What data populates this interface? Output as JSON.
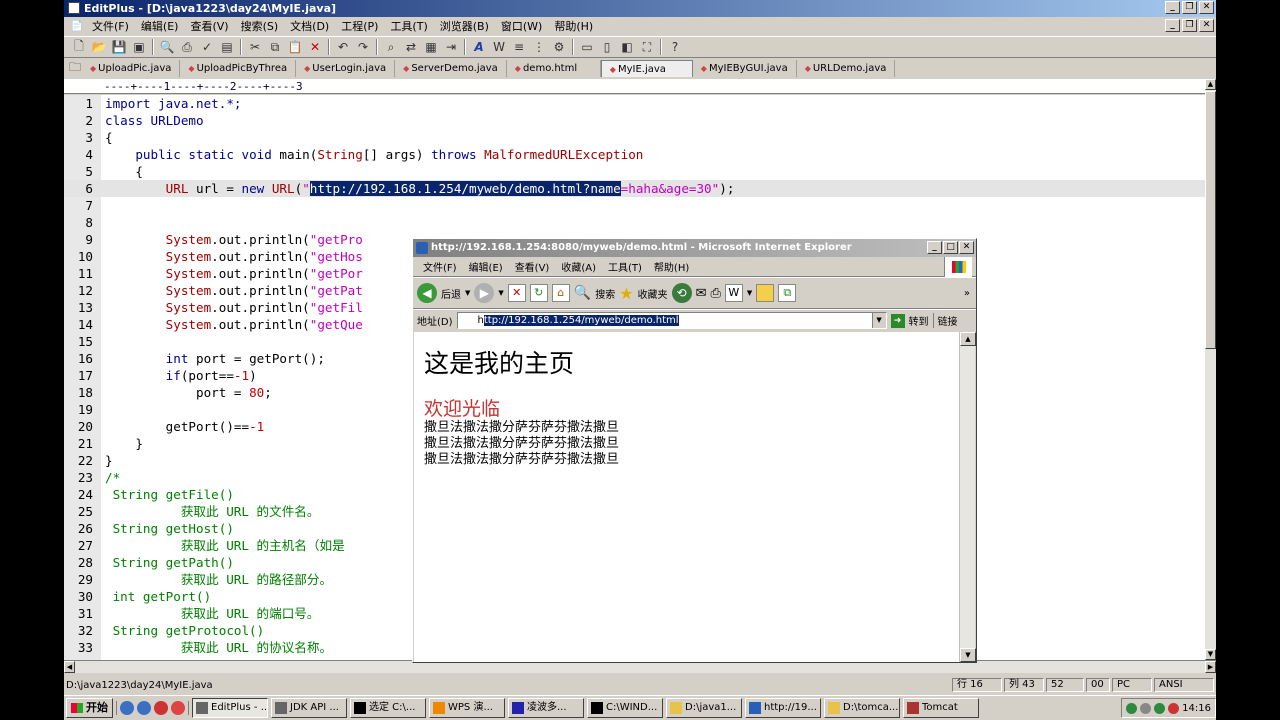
{
  "window": {
    "title": "EditPlus - [D:\\java1223\\day24\\MyIE.java]"
  },
  "menu": [
    "文件(F)",
    "编辑(E)",
    "查看(V)",
    "搜索(S)",
    "文档(D)",
    "工程(P)",
    "工具(T)",
    "浏览器(B)",
    "窗口(W)",
    "帮助(H)"
  ],
  "tabs": [
    {
      "label": "UploadPic.java",
      "active": false
    },
    {
      "label": "UploadPicByThrea",
      "active": false
    },
    {
      "label": "UserLogin.java",
      "active": false
    },
    {
      "label": "ServerDemo.java",
      "active": false
    },
    {
      "label": "demo.html",
      "active": false
    },
    {
      "label": "MyIE.java",
      "active": true
    },
    {
      "label": "MyIEByGUI.java",
      "active": false
    },
    {
      "label": "URLDemo.java",
      "active": false
    }
  ],
  "ruler": "----+----1----+----2----+----3",
  "line_numbers": [
    "1",
    "2",
    "3",
    "4",
    "5",
    "6",
    "7",
    "8",
    "9",
    "10",
    "11",
    "12",
    "13",
    "14",
    "15",
    "16",
    "17",
    "18",
    "19",
    "20",
    "21",
    "22",
    "23",
    "24",
    "25",
    "26",
    "27",
    "28",
    "29",
    "30",
    "31",
    "32",
    "33"
  ],
  "code": {
    "l1": "import java.net.*;",
    "l2": "class URLDemo",
    "l3": "{",
    "l4_kw": "public static void",
    "l4_main": " main(",
    "l4_type": "String",
    "l4_args": "[] args) ",
    "l4_throws": "throws",
    "l4_exc": " MalformedURLException",
    "l5": "{",
    "l6_type": "URL",
    "l6_a": " url = ",
    "l6_new": "new",
    "l6_b": " ",
    "l6_type2": "URL",
    "l6_c": "(",
    "l6_q": "\"",
    "l6_sel": "http://192.168.1.254/myweb/demo.html?name",
    "l6_rest": "=haha&age=30\"",
    "l6_end": ");",
    "sys": "System",
    "println": ".out.println(",
    "l9_s": "\"getPro",
    "l10_s": "\"getHos",
    "l11_s": "\"getPor",
    "l12_s": "\"getPat",
    "l13_s": "\"getFil",
    "l14_s": "\"getQue",
    "l16_kw": "int",
    "l16_rest": " port = getPort();",
    "l17_kw": "if",
    "l17_a": "(port==",
    "l17_n": "-1",
    "l17_b": ")",
    "l18_a": "port = ",
    "l18_n": "80",
    "l18_b": ";",
    "l20_a": "getPort()==",
    "l20_n": "-1",
    "l21": "}",
    "l22": "}",
    "l23": "/*",
    "l24": " String getFile()",
    "l25": "获取此 URL 的文件名。",
    "l26": " String getHost()",
    "l27": "获取此 URL 的主机名（如是",
    "l28": " String getPath()",
    "l29": "获取此 URL 的路径部分。",
    "l30": " int getPort()",
    "l31": "获取此 URL 的端口号。",
    "l32": " String getProtocol()",
    "l33": "获取此 URL 的协议名称。"
  },
  "ie": {
    "title": "http://192.168.1.254:8080/myweb/demo.html - Microsoft Internet Explorer",
    "menu": [
      "文件(F)",
      "编辑(E)",
      "查看(V)",
      "收藏(A)",
      "工具(T)",
      "帮助(H)"
    ],
    "back": "后退",
    "search": "搜索",
    "favorites": "收藏夹",
    "address_label": "地址(D)",
    "address_prefix": "h",
    "address_selected": "ttp://192.168.1.254/myweb/demo.html",
    "go": "转到",
    "links": "链接",
    "page_heading": "这是我的主页",
    "welcome": "欢迎光临",
    "para": [
      "撒旦法撒法撒分萨芬萨芬撒法撒旦",
      "撒旦法撒法撒分萨芬萨芬撒法撒旦",
      "撒旦法撒法撒分萨芬萨芬撒法撒旦"
    ]
  },
  "status": {
    "path": "D:\\java1223\\day24\\MyIE.java",
    "line": "行 16",
    "col": "列 43",
    "n1": "52",
    "n2": "00",
    "mode": "PC",
    "enc": "ANSI"
  },
  "taskbar": {
    "start": "开始",
    "tasks": [
      "EditPlus - ...",
      "JDK API ...",
      "选定 C:\\...",
      "WPS 演...",
      "凌波多...",
      "C:\\WIND...",
      "D:\\java1...",
      "http://19...",
      "D:\\tomca...",
      "Tomcat"
    ],
    "clock": "14:16"
  }
}
